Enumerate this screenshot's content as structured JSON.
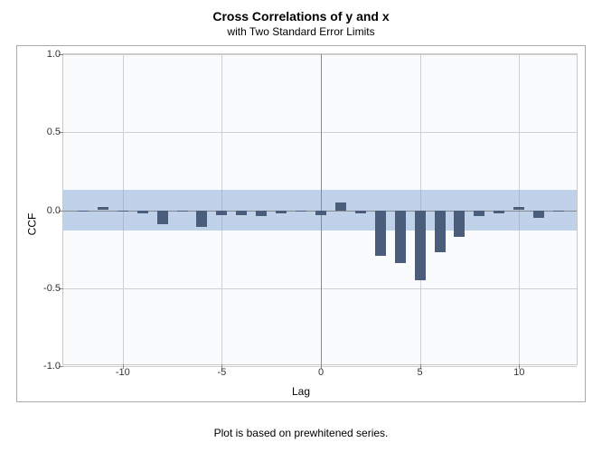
{
  "chart_data": {
    "type": "bar",
    "title": "Cross Correlations of y and x",
    "subtitle": "with Two Standard Error Limits",
    "xlabel": "Lag",
    "ylabel": "CCF",
    "footnote": "Plot is based on prewhitened series.",
    "xlim": [
      -13,
      13
    ],
    "ylim": [
      -1.0,
      1.0
    ],
    "x_ticks": [
      -10,
      -5,
      0,
      5,
      10
    ],
    "y_ticks": [
      -1.0,
      -0.5,
      0.0,
      0.5,
      1.0
    ],
    "y_tick_labels": [
      "-1.0",
      "-0.5",
      "0.0",
      "0.5",
      "1.0"
    ],
    "confidence_band": {
      "low": -0.13,
      "high": 0.13
    },
    "x": [
      -12,
      -11,
      -10,
      -9,
      -8,
      -7,
      -6,
      -5,
      -4,
      -3,
      -2,
      -1,
      0,
      1,
      2,
      3,
      4,
      5,
      6,
      7,
      8,
      9,
      10,
      11,
      12
    ],
    "values": [
      -0.01,
      0.02,
      -0.01,
      -0.02,
      -0.09,
      -0.01,
      -0.11,
      -0.03,
      -0.03,
      -0.04,
      -0.02,
      -0.01,
      -0.03,
      0.05,
      -0.02,
      -0.29,
      -0.34,
      -0.45,
      -0.27,
      -0.17,
      -0.04,
      -0.02,
      0.02,
      -0.05,
      -0.01
    ]
  }
}
